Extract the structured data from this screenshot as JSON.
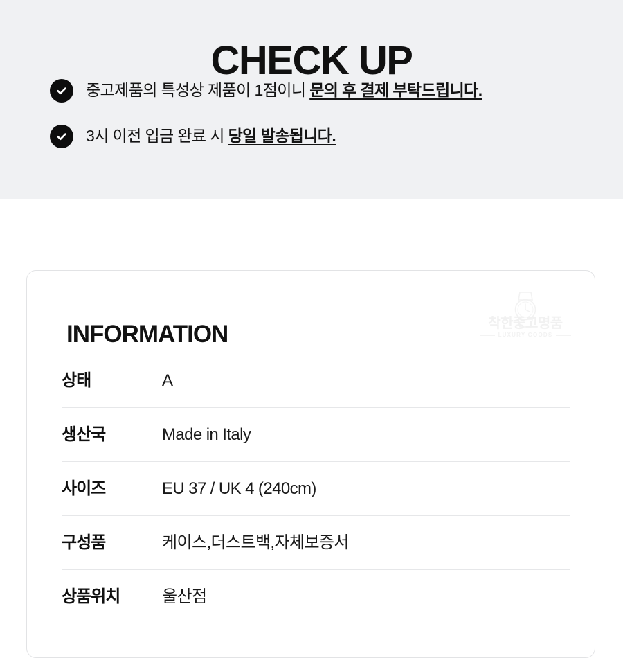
{
  "checkup": {
    "title": "CHECK UP",
    "icon": "check-circle-icon",
    "items": [
      {
        "plain_before": "중고제품의 특성상 제품이 1점이니 ",
        "emphasis": "문의 후 결제 부탁드립니다.",
        "full_text": "중고제품의 특성상 제품이 1점이니 문의 후 결제 부탁드립니다."
      },
      {
        "plain_before": "3시 이전 입금 완료 시 ",
        "emphasis": "당일 발송됩니다.",
        "full_text": "3시 이전 입금 완료 시 당일 발송됩니다."
      }
    ]
  },
  "information": {
    "heading": "INFORMATION",
    "watermark": {
      "icon": "wristwatch-icon",
      "brand": "착한중고명품",
      "sub": "LUXURY GOODS"
    },
    "rows": [
      {
        "label": "상태",
        "value": "A"
      },
      {
        "label": "생산국",
        "value": "Made in Italy"
      },
      {
        "label": "사이즈",
        "value": "EU 37 / UK 4 (240cm)"
      },
      {
        "label": "구성품",
        "value": "케이스,더스트백,자체보증서"
      },
      {
        "label": "상품위치",
        "value": "울산점"
      }
    ]
  },
  "colors": {
    "band_background": "#f0f1f3",
    "page_background": "#ffffff",
    "text": "#121212",
    "icon_fill": "#0d0d0d",
    "divider": "#e6e7e9",
    "card_border": "#e2e3e5",
    "watermark": "#f1f1f1"
  }
}
